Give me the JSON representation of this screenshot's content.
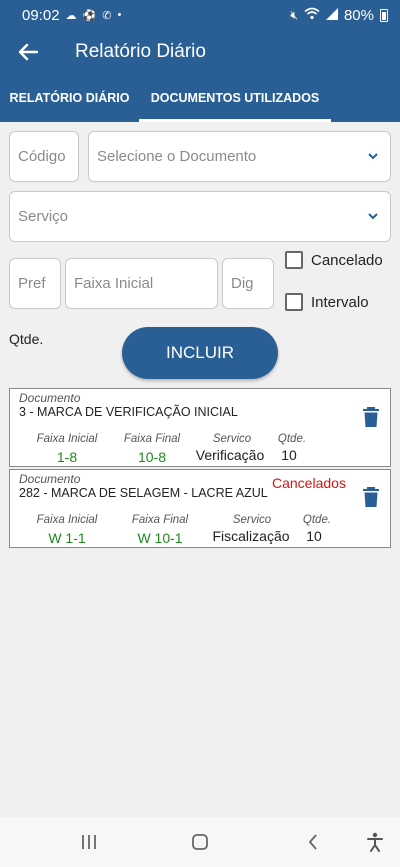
{
  "status_bar": {
    "time": "09:02",
    "battery": "80%"
  },
  "app_bar": {
    "title": "Relatório Diário"
  },
  "tabs": [
    {
      "label": "RELATÓRIO DIÁRIO",
      "active": false
    },
    {
      "label": "DOCUMENTOS UTILIZADOS",
      "active": true
    }
  ],
  "form": {
    "codigo_placeholder": "Código",
    "documento_placeholder": "Selecione o Documento",
    "servico_placeholder": "Serviço",
    "pref_placeholder": "Pref",
    "faixa_inicial_placeholder": "Faixa Inicial",
    "dig_placeholder": "Dig",
    "cancelado_label": "Cancelado",
    "intervalo_label": "Intervalo",
    "qtde_label": "Qtde.",
    "incluir_label": "INCLUIR"
  },
  "records": [
    {
      "doc_label": "Documento",
      "doc_name": "3 - MARCA DE VERIFICAÇÃO INICIAL",
      "status": "",
      "col_labels": {
        "faixa_inicial": "Faixa Inicial",
        "faixa_final": "Faixa Final",
        "servico": "Servico",
        "qtde": "Qtde."
      },
      "faixa_inicial": "1-8",
      "faixa_final": "10-8",
      "servico": "Verificação",
      "qtde": "10"
    },
    {
      "doc_label": "Documento",
      "doc_name": "282 - MARCA DE SELAGEM - LACRE AZUL",
      "status": "Cancelados",
      "col_labels": {
        "faixa_inicial": "Faixa Inicial",
        "faixa_final": "Faixa Final",
        "servico": "Servico",
        "qtde": "Qtde."
      },
      "faixa_inicial": "W 1-1",
      "faixa_final": "W 10-1",
      "servico": "Fiscalização",
      "qtde": "10"
    }
  ],
  "colors": {
    "primary": "#2a5f95",
    "green": "#1b8c1b",
    "red": "#d81414"
  }
}
